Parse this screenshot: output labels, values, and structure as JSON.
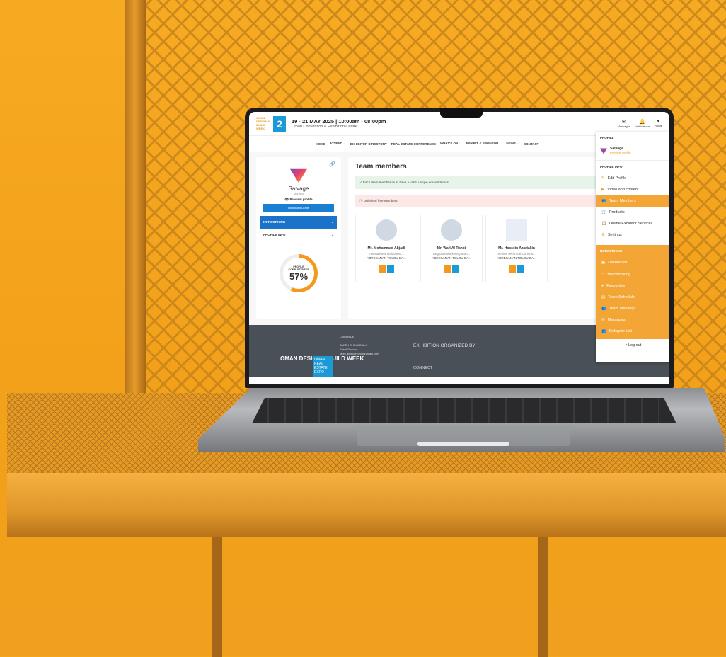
{
  "header": {
    "date": "19 - 21 MAY 2025 | 10:00am - 08:00pm",
    "venue": "Oman Convention & Exhibition Centre",
    "logo_text": "OMAN DESIGN & BUILD WEEK",
    "icons": [
      {
        "label": "Messages",
        "icon": "envelope-icon"
      },
      {
        "label": "Notifications",
        "icon": "bell-icon"
      },
      {
        "label": "Profile",
        "icon": "profile-icon"
      }
    ]
  },
  "nav": [
    "HOME",
    "ATTEND ⌄",
    "EXHIBITOR DIRECTORY",
    "REAL ESTATE CONFERENCE",
    "WHAT'S ON ⌄",
    "EXHIBIT & SPONSOR ⌄",
    "NEWS ⌄",
    "CONTACT"
  ],
  "sidebar": {
    "name": "Salvage",
    "location": "Monaco",
    "preview": "Preview profile",
    "download": "Download Leads",
    "accordion": [
      "NETWORKING",
      "PROFILE INFO"
    ],
    "completeness_label": "PROFILE COMPLETENESS",
    "completeness_value": "57%",
    "completeness_fraction": 0.57
  },
  "main": {
    "title": "Team members",
    "alert_ok": "Each team member must have a valid, unique email address",
    "alert_info": "Unlimited free members",
    "members": [
      {
        "name": "Mr. Mohammad Abjadi",
        "role": "International Relations ...",
        "company": "ABRESANAN TOLOU BA..."
      },
      {
        "name": "Mr. Wafi Al Rahbi",
        "role": "Regional Marketing Man...",
        "company": "ABRESANAN TOLOU BA..."
      },
      {
        "name": "Mr. Hossein Azartakin",
        "role": "Senior Technical Consult...",
        "company": "ABRESANAN TOLOU BA..."
      }
    ]
  },
  "footer": {
    "contact_title": "Contact Us",
    "contact_name": "TAREK CHEHAB ALI",
    "contact_role": "Event Director",
    "contact_email": "tarek.ali@connectthrought.com",
    "organized": "EXHIBITION ORGANIZED BY",
    "connect": "CONNECT",
    "logo1": "OMAN DESIGN & BUILD WEEK",
    "logo2": "OMAN REAL ESTATE EXPO"
  },
  "dropdown": {
    "profile_header": "PROFILE",
    "user_name": "Salvage",
    "user_preview": "Preview profile",
    "profile_info_header": "PROFILE INFO",
    "profile_items": [
      "Edit Profile",
      "Video and content",
      "Team Members",
      "Products",
      "Online Exhibitor Services",
      "Settings"
    ],
    "networking_header": "NETWORKING",
    "networking_items": [
      "Dashboard",
      "Matchmaking",
      "Favourites",
      "Team Schedule",
      "Team Meetings",
      "Messages",
      "Delegate List"
    ],
    "logout": "Log out"
  },
  "colors": {
    "accent": "#f39a1e",
    "blue": "#1a73c8",
    "background": "#f4a51c"
  }
}
